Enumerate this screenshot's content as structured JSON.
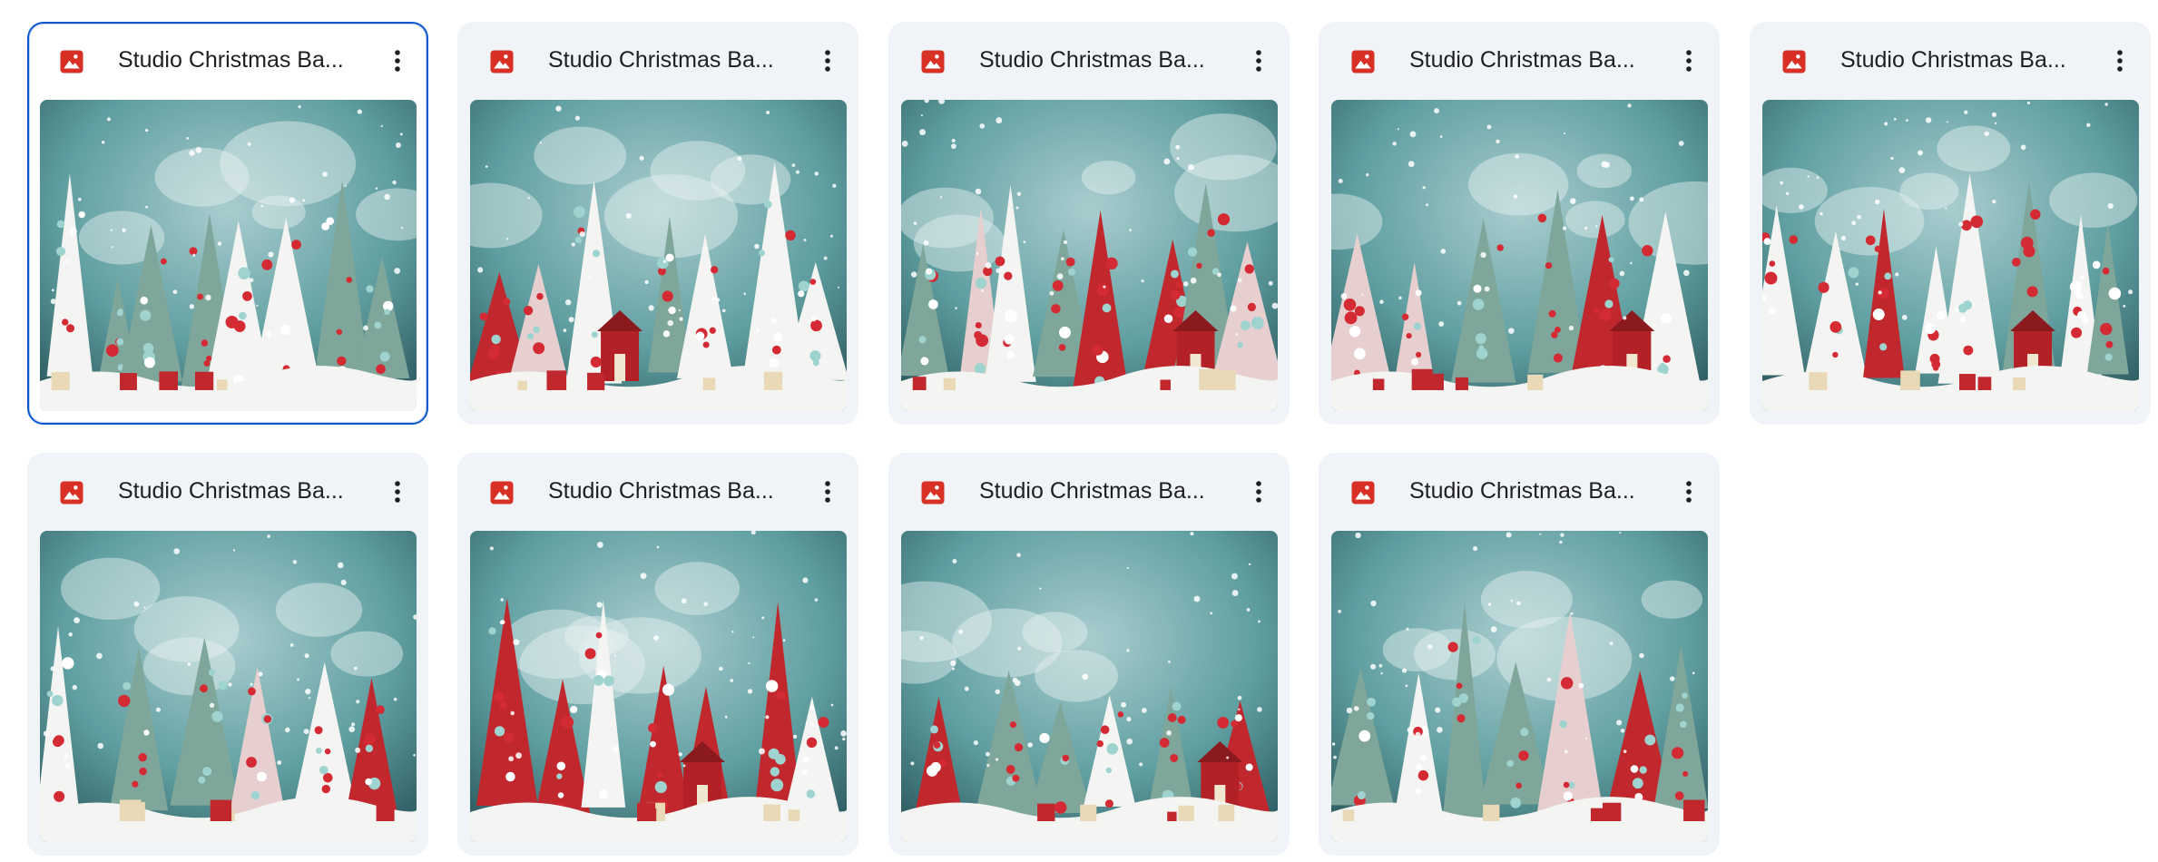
{
  "files": [
    {
      "name": "Studio Christmas Ba...",
      "type_icon": "image-icon",
      "selected": true
    },
    {
      "name": "Studio Christmas Ba...",
      "type_icon": "image-icon",
      "selected": false
    },
    {
      "name": "Studio Christmas Ba...",
      "type_icon": "image-icon",
      "selected": false
    },
    {
      "name": "Studio Christmas Ba...",
      "type_icon": "image-icon",
      "selected": false
    },
    {
      "name": "Studio Christmas Ba...",
      "type_icon": "image-icon",
      "selected": false
    },
    {
      "name": "Studio Christmas Ba...",
      "type_icon": "image-icon",
      "selected": false
    },
    {
      "name": "Studio Christmas Ba...",
      "type_icon": "image-icon",
      "selected": false
    },
    {
      "name": "Studio Christmas Ba...",
      "type_icon": "image-icon",
      "selected": false
    },
    {
      "name": "Studio Christmas Ba...",
      "type_icon": "image-icon",
      "selected": false
    }
  ],
  "colors": {
    "card_bg": "#f0f4f9",
    "selected_border": "#0b57d0",
    "image_icon": "#d93025",
    "backdrop_teal": "#5f9ea0",
    "tree_red": "#c0282d",
    "snow": "#f4f4f2"
  }
}
